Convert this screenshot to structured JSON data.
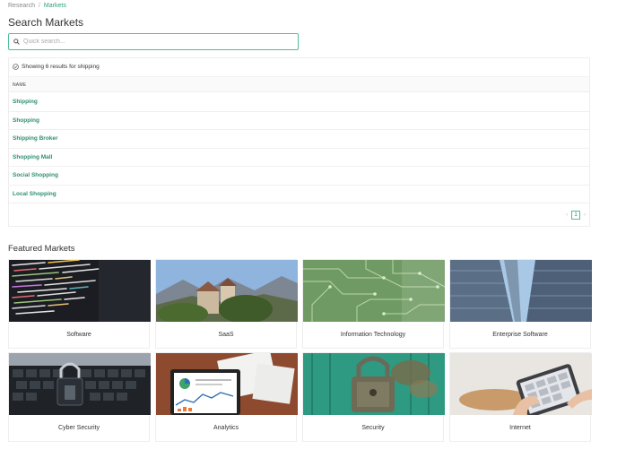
{
  "breadcrumb": {
    "parent": "Research",
    "separator": "/",
    "current": "Markets"
  },
  "title": "Search Markets",
  "search": {
    "placeholder": "Quick search...",
    "value": ""
  },
  "results": {
    "status": "Showing 6 results for shipping",
    "column_header": "NAME",
    "items": [
      "Shipping",
      "Shopping",
      "Shipping Broker",
      "Shopping Mall",
      "Social Shopping",
      "Local Shopping"
    ],
    "pagination": {
      "prev": "‹",
      "current_page": "1",
      "next": "›"
    }
  },
  "featured": {
    "title": "Featured Markets",
    "cards": [
      {
        "label": "Software",
        "image": "code-screen"
      },
      {
        "label": "SaaS",
        "image": "castle-mountains"
      },
      {
        "label": "Information Technology",
        "image": "circuit-board"
      },
      {
        "label": "Enterprise Software",
        "image": "skyscrapers"
      },
      {
        "label": "Cyber Security",
        "image": "padlock-keyboard"
      },
      {
        "label": "Analytics",
        "image": "dashboard-tablet"
      },
      {
        "label": "Security",
        "image": "rusty-padlock"
      },
      {
        "label": "Internet",
        "image": "tablet-hands"
      }
    ]
  },
  "colors": {
    "accent": "#2e8f72",
    "border_focus": "#4fbf9a"
  }
}
